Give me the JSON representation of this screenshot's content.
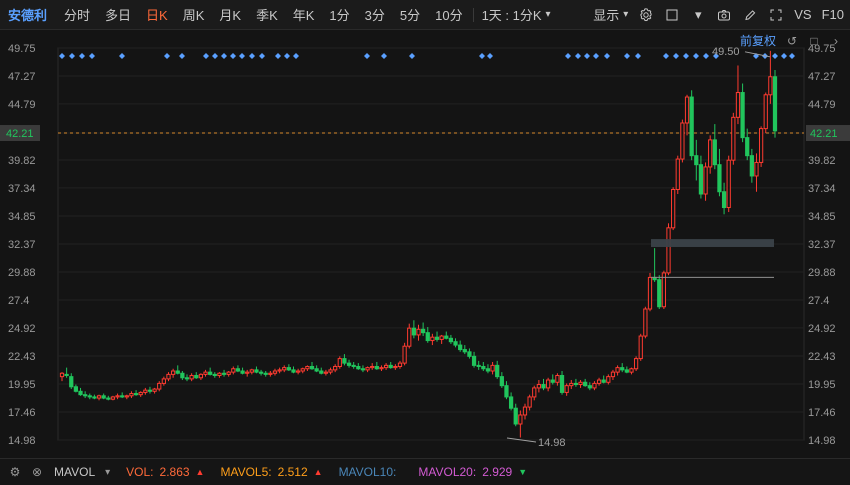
{
  "toolbar": {
    "stock_name": "安德利",
    "period_tabs": [
      {
        "label": "分时",
        "active": false
      },
      {
        "label": "多日",
        "active": false
      },
      {
        "label": "日K",
        "active": true
      },
      {
        "label": "周K",
        "active": false
      },
      {
        "label": "月K",
        "active": false
      },
      {
        "label": "季K",
        "active": false
      },
      {
        "label": "年K",
        "active": false
      },
      {
        "label": "1分",
        "active": false
      },
      {
        "label": "3分",
        "active": false
      },
      {
        "label": "5分",
        "active": false
      },
      {
        "label": "10分",
        "active": false
      }
    ],
    "period_select": "1天 : 1分K",
    "show_label": "显示",
    "vs_label": "VS",
    "f10_label": "F10"
  },
  "right_controls": {
    "fq_label": "前复权"
  },
  "chart_data": {
    "type": "candlestick",
    "y_axis": {
      "ticks": [
        49.75,
        47.27,
        44.79,
        42.21,
        39.82,
        37.34,
        34.85,
        32.37,
        29.88,
        27.4,
        24.92,
        22.43,
        19.95,
        17.46,
        14.98
      ],
      "ylim": [
        14.98,
        49.75
      ]
    },
    "current_price": 42.21,
    "annotations": {
      "high": 49.5,
      "low": 14.98
    },
    "candles": [
      [
        20.6,
        21.0,
        20.2,
        20.9
      ],
      [
        20.8,
        21.4,
        20.5,
        20.7
      ],
      [
        20.6,
        20.9,
        19.5,
        19.7
      ],
      [
        19.7,
        19.9,
        19.2,
        19.3
      ],
      [
        19.3,
        19.6,
        18.9,
        19.0
      ],
      [
        19.0,
        19.3,
        18.7,
        18.9
      ],
      [
        18.9,
        19.1,
        18.6,
        18.8
      ],
      [
        18.8,
        19.0,
        18.6,
        18.7
      ],
      [
        18.7,
        19.0,
        18.5,
        18.9
      ],
      [
        18.9,
        19.1,
        18.6,
        18.7
      ],
      [
        18.7,
        18.9,
        18.5,
        18.6
      ],
      [
        18.6,
        18.9,
        18.5,
        18.8
      ],
      [
        18.8,
        19.1,
        18.6,
        18.9
      ],
      [
        18.9,
        19.2,
        18.7,
        18.8
      ],
      [
        18.8,
        19.0,
        18.6,
        18.9
      ],
      [
        18.9,
        19.3,
        18.7,
        19.1
      ],
      [
        19.1,
        19.4,
        18.9,
        19.0
      ],
      [
        19.0,
        19.3,
        18.8,
        19.2
      ],
      [
        19.2,
        19.6,
        19.0,
        19.4
      ],
      [
        19.4,
        19.7,
        19.1,
        19.3
      ],
      [
        19.3,
        19.6,
        19.1,
        19.5
      ],
      [
        19.5,
        20.2,
        19.3,
        20.0
      ],
      [
        20.0,
        20.6,
        19.8,
        20.4
      ],
      [
        20.4,
        21.0,
        20.2,
        20.8
      ],
      [
        20.8,
        21.3,
        20.5,
        21.1
      ],
      [
        21.1,
        21.6,
        20.8,
        20.9
      ],
      [
        20.9,
        21.1,
        20.3,
        20.5
      ],
      [
        20.5,
        20.8,
        20.2,
        20.4
      ],
      [
        20.4,
        20.9,
        20.2,
        20.7
      ],
      [
        20.7,
        21.0,
        20.4,
        20.5
      ],
      [
        20.5,
        20.9,
        20.3,
        20.8
      ],
      [
        20.8,
        21.2,
        20.6,
        21.0
      ],
      [
        21.0,
        21.4,
        20.7,
        20.8
      ],
      [
        20.8,
        21.0,
        20.5,
        20.7
      ],
      [
        20.7,
        21.0,
        20.5,
        20.9
      ],
      [
        20.9,
        21.2,
        20.6,
        20.8
      ],
      [
        20.8,
        21.1,
        20.6,
        21.0
      ],
      [
        21.0,
        21.5,
        20.8,
        21.3
      ],
      [
        21.3,
        21.6,
        21.0,
        21.1
      ],
      [
        21.1,
        21.4,
        20.8,
        20.9
      ],
      [
        20.9,
        21.2,
        20.6,
        21.0
      ],
      [
        21.0,
        21.3,
        20.8,
        21.2
      ],
      [
        21.2,
        21.5,
        20.9,
        21.0
      ],
      [
        21.0,
        21.2,
        20.7,
        20.9
      ],
      [
        20.9,
        21.1,
        20.6,
        20.8
      ],
      [
        20.8,
        21.1,
        20.6,
        20.9
      ],
      [
        20.9,
        21.3,
        20.7,
        21.1
      ],
      [
        21.1,
        21.4,
        20.9,
        21.2
      ],
      [
        21.2,
        21.6,
        21.0,
        21.4
      ],
      [
        21.4,
        21.7,
        21.1,
        21.2
      ],
      [
        21.2,
        21.5,
        20.9,
        21.0
      ],
      [
        21.0,
        21.3,
        20.8,
        21.1
      ],
      [
        21.1,
        21.4,
        20.9,
        21.3
      ],
      [
        21.3,
        21.6,
        21.1,
        21.5
      ],
      [
        21.5,
        21.9,
        21.2,
        21.3
      ],
      [
        21.3,
        21.6,
        21.0,
        21.1
      ],
      [
        21.1,
        21.4,
        20.8,
        20.9
      ],
      [
        20.9,
        21.2,
        20.7,
        21.0
      ],
      [
        21.0,
        21.4,
        20.8,
        21.2
      ],
      [
        21.2,
        21.7,
        21.0,
        21.5
      ],
      [
        21.5,
        22.4,
        21.3,
        22.2
      ],
      [
        22.2,
        22.6,
        21.6,
        21.8
      ],
      [
        21.8,
        22.1,
        21.4,
        21.6
      ],
      [
        21.6,
        21.9,
        21.3,
        21.5
      ],
      [
        21.5,
        21.8,
        21.2,
        21.3
      ],
      [
        21.3,
        21.6,
        21.0,
        21.2
      ],
      [
        21.2,
        21.5,
        21.0,
        21.4
      ],
      [
        21.4,
        21.8,
        21.2,
        21.5
      ],
      [
        21.5,
        21.9,
        21.2,
        21.3
      ],
      [
        21.3,
        21.6,
        21.1,
        21.4
      ],
      [
        21.4,
        21.8,
        21.2,
        21.6
      ],
      [
        21.6,
        21.9,
        21.3,
        21.4
      ],
      [
        21.4,
        21.7,
        21.2,
        21.5
      ],
      [
        21.5,
        22.0,
        21.3,
        21.8
      ],
      [
        21.8,
        23.6,
        21.6,
        23.3
      ],
      [
        23.3,
        25.3,
        23.1,
        24.9
      ],
      [
        24.9,
        25.6,
        24.0,
        24.3
      ],
      [
        24.3,
        25.2,
        23.8,
        24.8
      ],
      [
        24.8,
        25.4,
        24.2,
        24.5
      ],
      [
        24.5,
        25.0,
        23.6,
        23.8
      ],
      [
        23.8,
        24.4,
        23.4,
        24.1
      ],
      [
        24.1,
        24.6,
        23.7,
        23.9
      ],
      [
        23.9,
        24.3,
        23.5,
        24.2
      ],
      [
        24.2,
        24.6,
        23.9,
        24.0
      ],
      [
        24.0,
        24.3,
        23.5,
        23.7
      ],
      [
        23.7,
        24.0,
        23.2,
        23.4
      ],
      [
        23.4,
        23.8,
        22.8,
        23.0
      ],
      [
        23.0,
        23.4,
        22.6,
        22.8
      ],
      [
        22.8,
        23.1,
        22.2,
        22.4
      ],
      [
        22.4,
        22.8,
        21.4,
        21.6
      ],
      [
        21.6,
        22.0,
        21.2,
        21.5
      ],
      [
        21.5,
        21.9,
        21.1,
        21.3
      ],
      [
        21.3,
        21.7,
        20.9,
        21.1
      ],
      [
        21.1,
        21.9,
        20.8,
        21.6
      ],
      [
        21.6,
        22.0,
        20.4,
        20.6
      ],
      [
        20.6,
        21.0,
        19.6,
        19.8
      ],
      [
        19.8,
        20.2,
        18.6,
        18.8
      ],
      [
        18.8,
        19.2,
        17.6,
        17.8
      ],
      [
        17.8,
        18.2,
        16.2,
        16.4
      ],
      [
        16.4,
        17.6,
        15.2,
        17.2
      ],
      [
        17.2,
        18.2,
        16.8,
        17.9
      ],
      [
        17.9,
        19.0,
        17.6,
        18.8
      ],
      [
        18.8,
        19.8,
        18.5,
        19.6
      ],
      [
        19.6,
        20.3,
        19.2,
        19.9
      ],
      [
        19.9,
        20.4,
        19.4,
        19.6
      ],
      [
        19.6,
        20.5,
        19.3,
        20.3
      ],
      [
        20.3,
        20.8,
        19.9,
        20.1
      ],
      [
        20.1,
        20.9,
        19.8,
        20.7
      ],
      [
        20.7,
        21.1,
        19.0,
        19.2
      ],
      [
        19.2,
        20.0,
        18.9,
        19.8
      ],
      [
        19.8,
        20.3,
        19.5,
        20.0
      ],
      [
        20.0,
        20.4,
        19.7,
        19.9
      ],
      [
        19.9,
        20.3,
        19.6,
        20.1
      ],
      [
        20.1,
        20.4,
        19.7,
        19.8
      ],
      [
        19.8,
        20.1,
        19.4,
        19.6
      ],
      [
        19.6,
        20.2,
        19.4,
        20.0
      ],
      [
        20.0,
        20.5,
        19.8,
        20.3
      ],
      [
        20.3,
        20.7,
        20.0,
        20.1
      ],
      [
        20.1,
        20.8,
        19.9,
        20.6
      ],
      [
        20.6,
        21.2,
        20.3,
        21.0
      ],
      [
        21.0,
        21.6,
        20.7,
        21.4
      ],
      [
        21.4,
        21.8,
        21.0,
        21.2
      ],
      [
        21.2,
        21.5,
        20.9,
        21.0
      ],
      [
        21.0,
        21.4,
        20.8,
        21.3
      ],
      [
        21.3,
        22.4,
        21.1,
        22.2
      ],
      [
        22.2,
        24.4,
        22.0,
        24.2
      ],
      [
        24.2,
        26.8,
        24.0,
        26.6
      ],
      [
        26.6,
        29.8,
        26.4,
        29.4
      ],
      [
        29.4,
        32.0,
        29.0,
        29.2
      ],
      [
        29.2,
        29.6,
        26.6,
        26.8
      ],
      [
        26.8,
        30.0,
        26.6,
        29.8
      ],
      [
        29.8,
        34.2,
        29.6,
        33.8
      ],
      [
        33.8,
        37.4,
        33.6,
        37.2
      ],
      [
        37.2,
        40.2,
        36.8,
        39.9
      ],
      [
        39.9,
        43.4,
        39.6,
        43.1
      ],
      [
        43.1,
        45.6,
        42.0,
        45.4
      ],
      [
        45.4,
        46.0,
        39.8,
        40.2
      ],
      [
        40.2,
        41.6,
        38.0,
        39.4
      ],
      [
        39.4,
        40.2,
        36.4,
        36.8
      ],
      [
        36.8,
        39.6,
        36.2,
        39.2
      ],
      [
        39.2,
        42.0,
        38.6,
        41.6
      ],
      [
        41.6,
        43.0,
        39.0,
        39.4
      ],
      [
        39.4,
        40.8,
        36.6,
        37.0
      ],
      [
        37.0,
        37.8,
        35.0,
        35.6
      ],
      [
        35.6,
        40.2,
        35.2,
        39.8
      ],
      [
        39.8,
        44.0,
        39.4,
        43.6
      ],
      [
        43.6,
        48.2,
        43.0,
        45.8
      ],
      [
        45.8,
        46.6,
        41.4,
        41.8
      ],
      [
        41.8,
        42.6,
        39.8,
        40.2
      ],
      [
        40.2,
        40.8,
        37.8,
        38.4
      ],
      [
        38.4,
        40.4,
        37.0,
        39.6
      ],
      [
        39.6,
        42.8,
        39.2,
        42.6
      ],
      [
        42.6,
        45.8,
        42.2,
        45.6
      ],
      [
        45.6,
        49.5,
        44.8,
        47.2
      ],
      [
        47.2,
        47.8,
        41.8,
        42.4
      ]
    ],
    "resistance_zone": [
      32.1,
      32.8
    ],
    "support_line": 29.4
  },
  "indicator_bar": {
    "indicator_name": "MAVOL",
    "items": [
      {
        "name": "VOL:",
        "value": "2.863",
        "dir": "up",
        "color": "#ff6a3a"
      },
      {
        "name": "MAVOL5:",
        "value": "2.512",
        "dir": "up",
        "color": "#ff9f1a"
      },
      {
        "name": "MAVOL10:",
        "value": "",
        "dir": "",
        "color": "#4a86b8"
      },
      {
        "name": "MAVOL20:",
        "value": "2.929",
        "dir": "down",
        "color": "#d35bd3"
      }
    ]
  },
  "colors": {
    "up": "#ff3b30",
    "down": "#21c55d",
    "dotted_price": "#d88a2b",
    "marker": "#5aa0ff"
  }
}
